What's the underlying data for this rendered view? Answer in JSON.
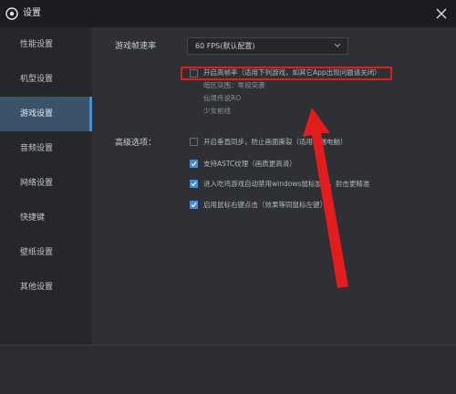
{
  "window": {
    "title": "设置",
    "close_icon": "close-icon"
  },
  "sidebar": {
    "items": [
      {
        "label": "性能设置"
      },
      {
        "label": "机型设置"
      },
      {
        "label": "游戏设置",
        "active": true
      },
      {
        "label": "音频设置"
      },
      {
        "label": "网络设置"
      },
      {
        "label": "快捷键"
      },
      {
        "label": "壁纸设置"
      },
      {
        "label": "其他设置"
      }
    ]
  },
  "game": {
    "fps_label": "游戏帧速率",
    "fps_value": "60 FPS(默认配置)",
    "high_fps": {
      "label": "开启高帧率（适用下列游戏，如其它App出现问题请关闭）",
      "checked": false,
      "games": [
        "暗区突围：零规突袭",
        "仙境传说RO",
        "少女前线"
      ]
    },
    "advanced_label": "高级选项：",
    "options": [
      {
        "label": "开启垂直同步，防止画面撕裂（适用高端电脑）",
        "checked": false
      },
      {
        "label": "支持ASTC纹理（画质更高清）",
        "checked": true
      },
      {
        "label": "进入吃鸡游戏自动禁用windows鼠标加速，射击更精准",
        "checked": true
      },
      {
        "label": "启用鼠标右键点击（效果等同鼠标左键）",
        "checked": true
      }
    ]
  },
  "annotation": {
    "highlight_color": "#e31d1d"
  },
  "colors": {
    "accent": "#3d8ee0",
    "active_bg": "#3a5369"
  }
}
